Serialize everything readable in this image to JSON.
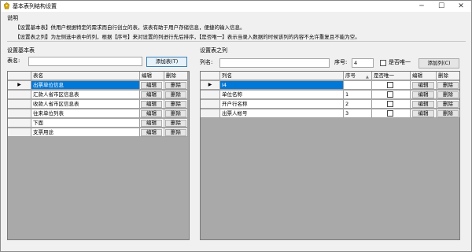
{
  "window": {
    "title": "基本表列结构设置",
    "controls": {
      "minimize": "─",
      "maximize": "☐",
      "close": "✕"
    }
  },
  "description": {
    "label": "说明",
    "line1": "【设置基本表】供用户根据特定的需求而自行创立的表，该表有助于用户存储信息，便捷的输入信息。",
    "line2": "【设置表之列】为左侧选中表中的列，根据【序号】来对设置的列进行先后排序，【是否唯一】表示当录入数据的时候该列的内容不允许重复且不能为空。"
  },
  "left": {
    "group_title": "设置基本表",
    "table_name_label": "表名:",
    "table_name_value": "",
    "add_button": "添加表(T)",
    "columns": [
      "表名",
      "编辑",
      "删除"
    ],
    "row_marker": "▶",
    "edit_label": "编辑",
    "delete_label": "删除",
    "rows": [
      {
        "name": "出票单位信息",
        "selected": true
      },
      {
        "name": "汇款人省市区信息表",
        "selected": false
      },
      {
        "name": "收款人省市区信息表",
        "selected": false
      },
      {
        "name": "往来单位列表",
        "selected": false
      },
      {
        "name": "下面",
        "selected": false
      },
      {
        "name": "支票用途",
        "selected": false
      }
    ]
  },
  "right": {
    "group_title": "设置表之列",
    "col_name_label": "列名:",
    "col_name_value": "",
    "seq_label": "序号:",
    "seq_value": "4",
    "unique_label": "是否唯一",
    "add_button": "添加列(C)",
    "columns": [
      "列名",
      "序号",
      "是否唯一",
      "编辑",
      "删除"
    ],
    "sort_arrow": "▲",
    "row_marker": "▶",
    "edit_label": "编辑",
    "delete_label": "删除",
    "rows": [
      {
        "name": "I4",
        "seq": "",
        "unique": false,
        "selected": true
      },
      {
        "name": "单位名称",
        "seq": "1",
        "unique": false,
        "selected": false
      },
      {
        "name": "开户行名称",
        "seq": "2",
        "unique": false,
        "selected": false
      },
      {
        "name": "出票人帐号",
        "seq": "3",
        "unique": false,
        "selected": false
      }
    ]
  }
}
